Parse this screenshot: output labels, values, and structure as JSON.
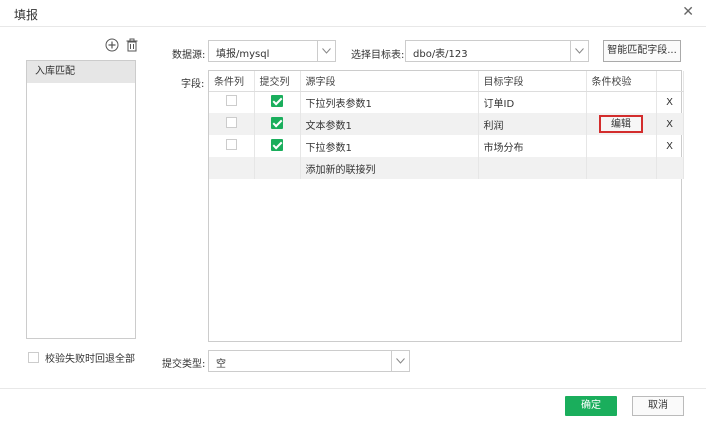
{
  "window": {
    "title": "填报"
  },
  "left_panel": {
    "items": [
      {
        "label": "入库匹配"
      }
    ],
    "rollback_label": "校验失败时回退全部",
    "rollback_checked": false
  },
  "datasource": {
    "label": "数据源:",
    "value": "填报/mysql"
  },
  "target_table": {
    "label": "选择目标表:",
    "value": "dbo/表/123"
  },
  "smart_match_button": "智能匹配字段...",
  "fields": {
    "label": "字段:",
    "columns": [
      "条件列",
      "提交列",
      "源字段",
      "目标字段",
      "条件校验",
      ""
    ],
    "rows": [
      {
        "condition": false,
        "submit": true,
        "source": "下拉列表参数1",
        "target": "订单ID",
        "check": "",
        "remove": "X"
      },
      {
        "condition": false,
        "submit": true,
        "source": "文本参数1",
        "target": "利润",
        "check": "编辑",
        "remove": "X"
      },
      {
        "condition": false,
        "submit": true,
        "source": "下拉参数1",
        "target": "市场分布",
        "check": "",
        "remove": "X"
      }
    ],
    "add_row_label": "添加新的联接列"
  },
  "submit_type": {
    "label": "提交类型:",
    "value": "空"
  },
  "footer": {
    "ok": "确定",
    "cancel": "取消"
  },
  "colors": {
    "accent_green": "#1aae5c",
    "highlight_red": "#d32d2d"
  }
}
